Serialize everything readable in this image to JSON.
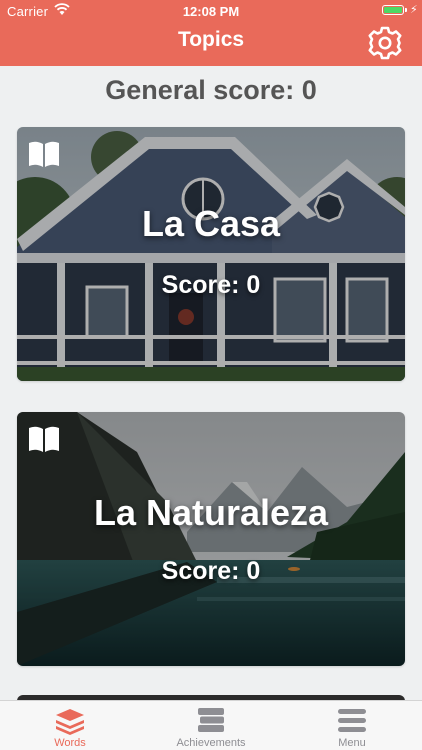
{
  "status_bar": {
    "carrier": "Carrier",
    "time": "12:08 PM",
    "battery_level": 1.0
  },
  "nav": {
    "title": "Topics",
    "settings_icon": "gear-icon"
  },
  "general_score": "General score: 0",
  "topics": [
    {
      "title": "La Casa",
      "score": "Score: 0",
      "icon": "book-icon"
    },
    {
      "title": "La Naturaleza",
      "score": "Score: 0",
      "icon": "book-icon"
    }
  ],
  "tabs": [
    {
      "label": "Words",
      "icon": "stack-icon",
      "active": true
    },
    {
      "label": "Achievements",
      "icon": "books-icon",
      "active": false
    },
    {
      "label": "Menu",
      "icon": "menu-icon",
      "active": false
    }
  ],
  "colors": {
    "accent": "#e96a5a",
    "background": "#eef0f1",
    "score_text": "#555555",
    "inactive_tab": "#8e8e93"
  }
}
